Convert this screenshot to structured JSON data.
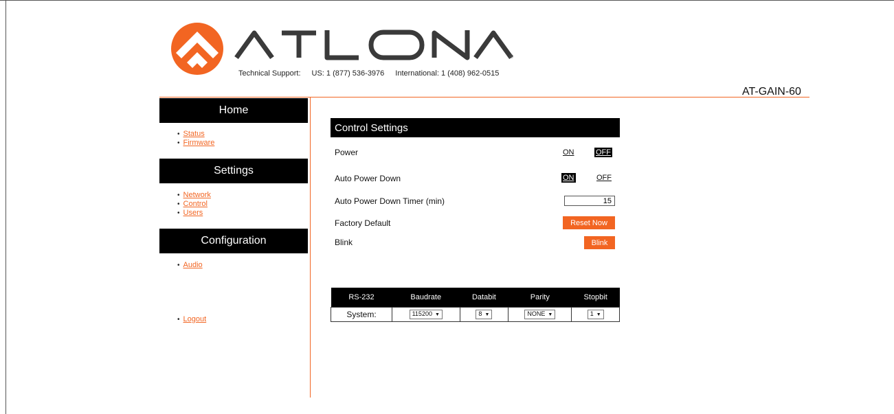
{
  "brand": {
    "name": "ATLONA",
    "registered": "®",
    "support_label": "Technical Support:",
    "support_us": "US: 1 (877) 536-3976",
    "support_intl": "International: 1 (408) 962-0515",
    "accent": "#f26522"
  },
  "model": "AT-GAIN-60",
  "sidebar": {
    "sections": [
      {
        "title": "Home",
        "items": [
          "Status",
          "Firmware"
        ]
      },
      {
        "title": "Settings",
        "items": [
          "Network",
          "Control",
          "Users"
        ]
      },
      {
        "title": "Configuration",
        "items": [
          "Audio"
        ]
      }
    ],
    "logout": "Logout"
  },
  "control": {
    "title": "Control Settings",
    "power": {
      "label": "Power",
      "on": "ON",
      "off": "OFF",
      "state": "OFF"
    },
    "auto_power_down": {
      "label": "Auto Power Down",
      "on": "ON",
      "off": "OFF",
      "state": "ON"
    },
    "timer": {
      "label": "Auto Power Down Timer (min)",
      "value": "15"
    },
    "factory": {
      "label": "Factory Default",
      "button": "Reset Now"
    },
    "blink": {
      "label": "Blink",
      "button": "Blink"
    }
  },
  "rs232": {
    "headers": [
      "RS-232",
      "Baudrate",
      "Databit",
      "Parity",
      "Stopbit"
    ],
    "row": {
      "name": "System:",
      "baudrate": "115200",
      "databit": "8",
      "parity": "NONE",
      "stopbit": "1"
    }
  }
}
